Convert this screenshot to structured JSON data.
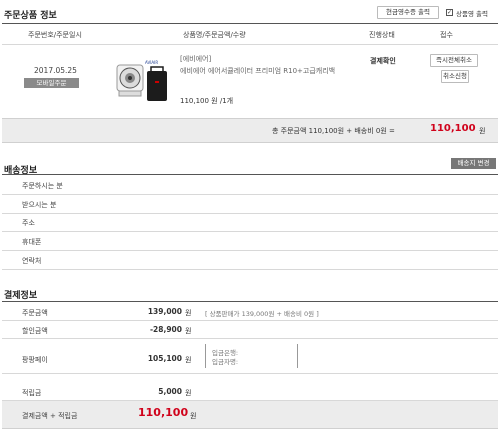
{
  "order_section": {
    "title": "주문상품 정보",
    "receipt_button": "현금영수증 출력",
    "product_receipt_label": "상품영 출력",
    "headers": [
      "주문번호/주문일시",
      "상품명/주문금액/수량",
      "진행상태",
      "접수"
    ],
    "date": "2017.05.25",
    "channel_badge": "모바일주문",
    "brand": "[에비에어]",
    "product_name": "에비에어 에어서큘레이터 프리미엄 R10+고급캐리백",
    "price_qty": "110,100 원 /1개",
    "status": "결제확인",
    "cancel_now_button": "즉시전체취소",
    "cancel_request_button": "취소신청",
    "summary_prefix": "총 주문금액 110,100원 + 배송비 0원 =",
    "summary_total": "110,100",
    "summary_unit": "원"
  },
  "shipping_section": {
    "title": "배송정보",
    "change_button": "배송지 변경",
    "rows": [
      "주문하시는 분",
      "받으시는 분",
      "주소",
      "휴대폰",
      "연락처"
    ]
  },
  "payment_section": {
    "title": "결제정보",
    "rows": [
      {
        "label": "주문금액",
        "value": "139,000",
        "unit": "원",
        "note": "[ 상품판매가 139,000원 + 배송비 0원 ]"
      },
      {
        "label": "할인금액",
        "value": "-28,900",
        "unit": "원"
      },
      {
        "label": "팡팡페이",
        "value": "105,100",
        "unit": "원",
        "bank_label": "입금은행:",
        "depositor_label": "입금자명:"
      },
      {
        "label": "적립금",
        "value": "5,000",
        "unit": "원"
      }
    ],
    "total_label": "결제금액 + 적립금",
    "total_value": "110,100",
    "total_unit": "원"
  },
  "colors": {
    "accent_red": "#d0021b",
    "badge_grey": "#8a8a8a",
    "summary_bg": "#ececec"
  }
}
